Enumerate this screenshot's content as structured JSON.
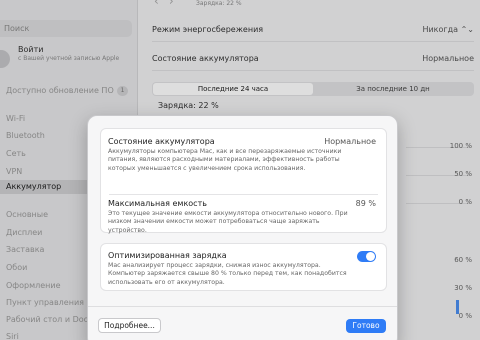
{
  "sidebar": {
    "search_placeholder": "Поиск",
    "account": {
      "title": "Войти",
      "subtitle": "с Вашей учетной записью Apple"
    },
    "update": {
      "label": "Доступно обновление ПО",
      "count": "1"
    },
    "items": [
      {
        "label": "Wi-Fi",
        "state": "dim"
      },
      {
        "label": "Bluetooth",
        "state": "dim"
      },
      {
        "label": "Сеть",
        "state": "dim"
      },
      {
        "label": "VPN",
        "state": "dim"
      },
      {
        "label": "Аккумулятор",
        "state": "active"
      },
      {
        "label": "Основные",
        "state": "dim"
      },
      {
        "label": "Дисплеи",
        "state": "dim"
      },
      {
        "label": "Заставка",
        "state": "dim"
      },
      {
        "label": "Обои",
        "state": "dim"
      },
      {
        "label": "Оформление",
        "state": "dim"
      },
      {
        "label": "Пункт управления",
        "state": "dim"
      },
      {
        "label": "Рабочий стол и Dock",
        "state": "dim"
      },
      {
        "label": "Siri",
        "state": "dim"
      }
    ]
  },
  "main": {
    "nav_back": "‹",
    "nav_forward": "›",
    "charge_top": "Зарядка: 22 %",
    "energy_mode": {
      "label": "Режим энергосбережения",
      "value": "Никогда ⌃⌄"
    },
    "battery_state": {
      "label": "Состояние аккумулятора",
      "value": "Нормальное"
    },
    "tabs": [
      "Последние 24 часа",
      "За последние 10 дн"
    ],
    "charge_label": "Зарядка: 22 %",
    "axis": [
      "100 %",
      "50 %",
      "0 %",
      "60 %",
      "30 %",
      "0 %"
    ]
  },
  "modal": {
    "health": {
      "title": "Состояние аккумулятора",
      "value": "Нормальное",
      "description": "Аккумуляторы компьютера Mac, как и все перезаряжаемые источники питания, являются расходными материалами, эффективность работы которых уменьшается с увеличением срока использования."
    },
    "capacity": {
      "title": "Максимальная емкость",
      "value": "89 %",
      "description": "Это текущее значение емкости аккумулятора относительно нового. При низком значении емкости может потребоваться чаще заряжать устройство."
    },
    "optimized": {
      "title": "Оптимизированная зарядка",
      "enabled": true,
      "description": "Mac анализирует процесс зарядки, снижая износ аккумулятора. Компьютер заряжается свыше 80 % только перед тем, как понадобится использовать его от аккумулятора."
    },
    "more_button": "Подробнее...",
    "done_button": "Готово"
  },
  "colors": {
    "accent": "#2f7cf6",
    "green": "#5cc45e"
  }
}
